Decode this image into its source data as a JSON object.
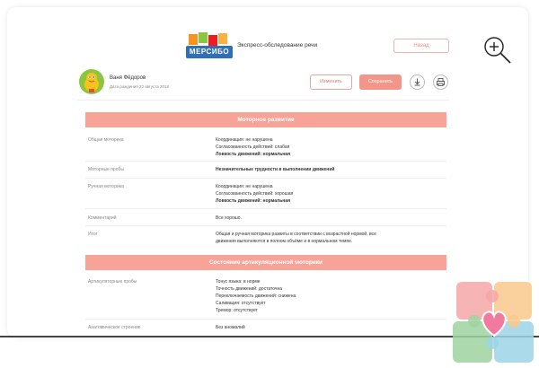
{
  "header": {
    "logo_text": "МЕРСИБО",
    "title": "Экспресс-обследование речи",
    "back_label": "Назад"
  },
  "user": {
    "name": "Ваня Фёдоров",
    "date": "Дата рождения 22 августа 2018"
  },
  "actions": {
    "edit_label": "Изменить",
    "save_label": "Сохранить"
  },
  "colors": {
    "accent": "#f7a398",
    "avatar": "#8cc63f"
  },
  "sections": [
    {
      "title": "Моторное развитие",
      "rows": [
        {
          "label": "Общая моторика",
          "lines": [
            "Координация: не нарушена",
            "Согласованность действий: слабая",
            "Ловкость движений: нормальная"
          ]
        },
        {
          "label": "Моторные пробы",
          "lines": [
            "Незначительные трудности в выполнении движений"
          ]
        },
        {
          "label": "Ручная моторика",
          "lines": [
            "Координация: не нарушена",
            "Согласованность действий: хорошая",
            "Ловкость движений: нормальная"
          ]
        },
        {
          "label": "Комментарий",
          "lines": [
            "Все хорошо."
          ]
        },
        {
          "label": "Итог",
          "lines": [
            "Общая и ручная моторика развиты в соответствии с возрастной нормой, все",
            "движения выполняются в полном объёме и в нормальном темпе."
          ]
        }
      ]
    },
    {
      "title": "Состояние артикуляционной моторики",
      "rows": [
        {
          "label": "Артикуляторные пробы",
          "lines": [
            "Тонус языка: в норме",
            "Точность движений: достаточна",
            "Переключаемость движений: снижена",
            "Саливация: отсутствует",
            "Тремор: отсутствует"
          ]
        },
        {
          "label": "Анатомическое строение",
          "lines": [
            "Без аномалий"
          ]
        }
      ]
    }
  ]
}
